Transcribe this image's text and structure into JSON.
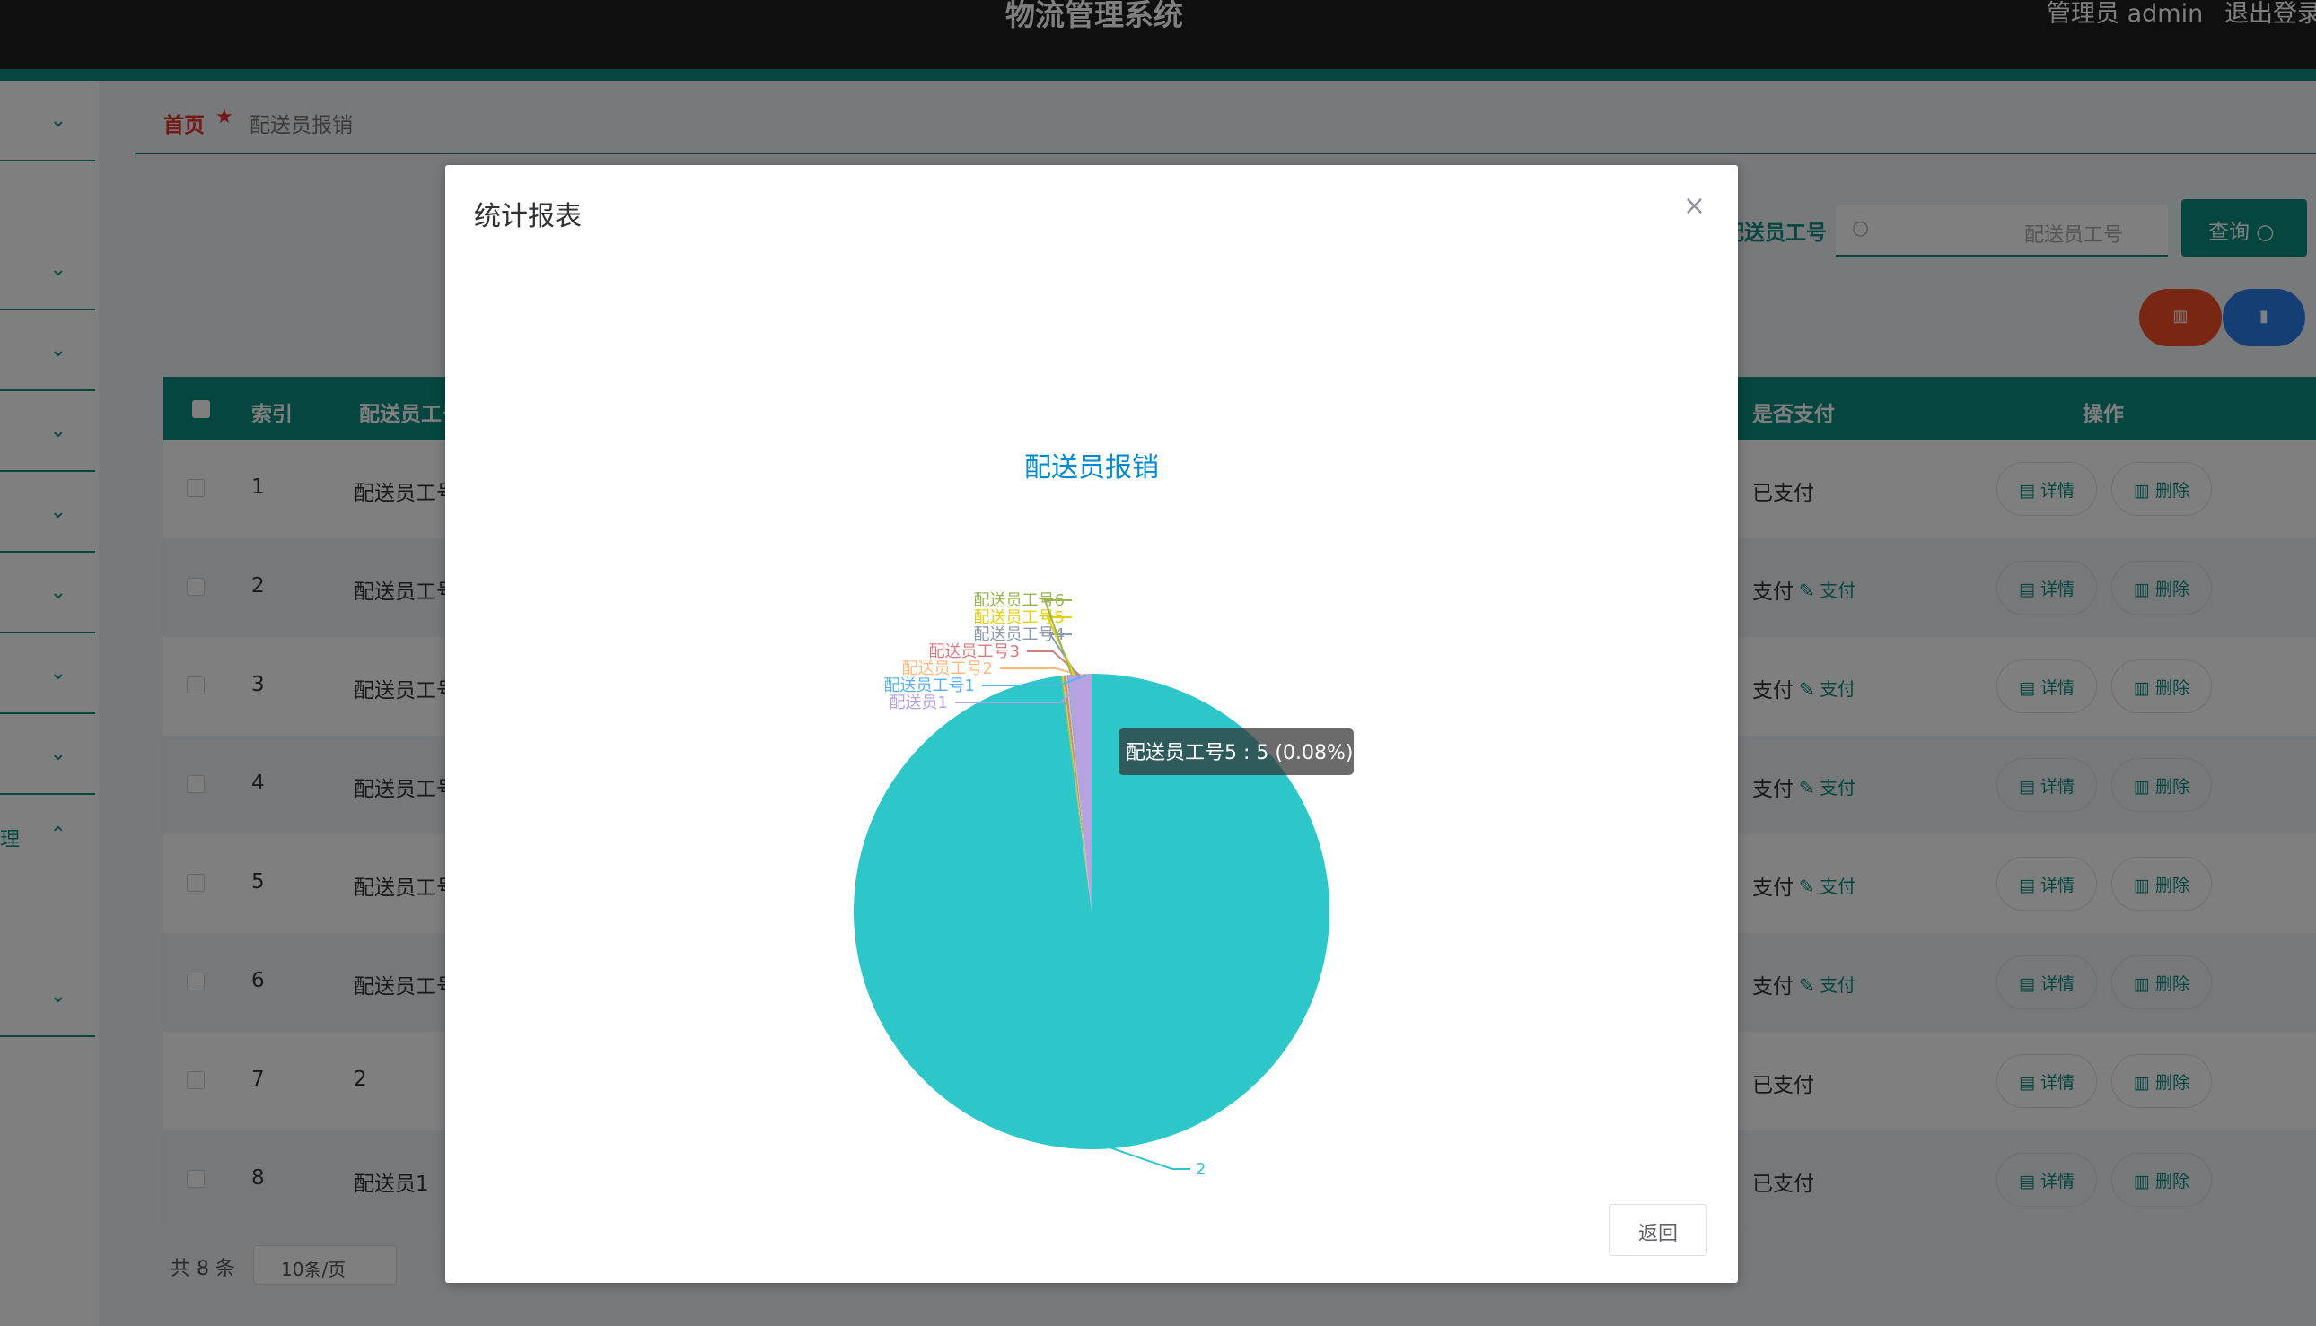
{
  "header": {
    "title": "物流管理系统",
    "admin": "管理员 admin",
    "logout": "退出登录"
  },
  "sidebar": {
    "partial_label": "理"
  },
  "breadcrumb": {
    "home": "首页",
    "current": "配送员报销"
  },
  "search": {
    "label": "配送员工号",
    "placeholder": "配送员工号",
    "button": "查询"
  },
  "table": {
    "headers": {
      "index": "索引",
      "staff_no": "配送员工号",
      "paid": "是否支付",
      "ops": "操作"
    },
    "rows": [
      {
        "index": "1",
        "staff": "配送员工号",
        "status": "已支付",
        "pay": ""
      },
      {
        "index": "2",
        "staff": "配送员工号",
        "status": "支付",
        "pay": "支付"
      },
      {
        "index": "3",
        "staff": "配送员工号",
        "status": "支付",
        "pay": "支付"
      },
      {
        "index": "4",
        "staff": "配送员工号",
        "status": "支付",
        "pay": "支付"
      },
      {
        "index": "5",
        "staff": "配送员工号",
        "status": "支付",
        "pay": "支付"
      },
      {
        "index": "6",
        "staff": "配送员工号",
        "status": "支付",
        "pay": "支付"
      },
      {
        "index": "7",
        "staff": "2",
        "status": "已支付",
        "pay": ""
      },
      {
        "index": "8",
        "staff": "配送员1",
        "status": "已支付",
        "pay": ""
      }
    ],
    "detail_label": "详情",
    "delete_label": "删除"
  },
  "pager": {
    "total": "共 8 条",
    "size": "10条/页"
  },
  "dialog": {
    "title": "统计报表",
    "close": "×",
    "return": "返回"
  },
  "chart_data": {
    "type": "pie",
    "title": "配送员报销",
    "slices": [
      {
        "label": "2",
        "value": 5943,
        "color": "#2ec7c9"
      },
      {
        "label": "配送员1",
        "value": 95,
        "color": "#b6a2de"
      },
      {
        "label": "配送员工号1",
        "value": 5,
        "color": "#5ab1ef"
      },
      {
        "label": "配送员工号2",
        "value": 5,
        "color": "#ffb980"
      },
      {
        "label": "配送员工号3",
        "value": 5,
        "color": "#d87a80"
      },
      {
        "label": "配送员工号4",
        "value": 5,
        "color": "#8d98b3"
      },
      {
        "label": "配送员工号5",
        "value": 5,
        "color": "#e5cf0d"
      },
      {
        "label": "配送员工号6",
        "value": 5,
        "color": "#97b552"
      }
    ],
    "tooltip": "配送员工号5 : 5 (0.08%)"
  }
}
